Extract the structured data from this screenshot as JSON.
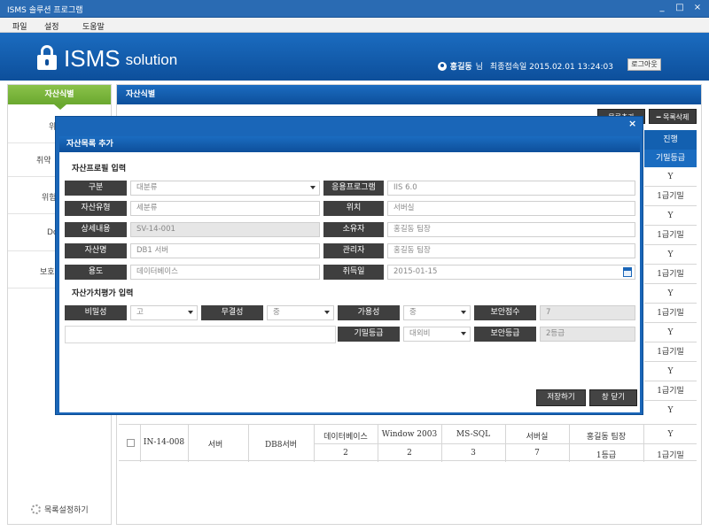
{
  "window": {
    "title": "ISMS 솔루션 프로그램",
    "controls": [
      "_",
      "□",
      "×"
    ]
  },
  "menu": [
    "파일",
    "설정",
    "도움말"
  ],
  "header": {
    "logo_big": "ISMS",
    "logo_small": "solution",
    "user_name": "홍길동",
    "user_suffix": "님",
    "last_login": "최종접속일 2015.02.01 13:24:03",
    "logout": "로그아웃"
  },
  "sidebar": {
    "title": "자산식별",
    "items": [
      "위",
      "취약",
      "위험",
      "Do",
      "보호"
    ],
    "footer": "목록설정하기"
  },
  "main": {
    "title": "자산식별",
    "add_button": "목록추가",
    "delete_button": "━ 목록삭제",
    "column_header": "진행",
    "column_sub": "기밀등급",
    "right_column": [
      "Y",
      "1급기밀",
      "Y",
      "1급기밀",
      "Y",
      "1급기밀",
      "Y",
      "1급기밀",
      "Y",
      "1급기밀",
      "Y",
      "1급기밀",
      "Y"
    ],
    "last_row": {
      "id": "IN-14-008",
      "type": "서버",
      "name": "DB8서버",
      "top": [
        "데이터베이스",
        "Window 2003",
        "MS-SQL",
        "서버실",
        "홍길동 팀장",
        "Y"
      ],
      "bottom": [
        "2",
        "2",
        "3",
        "7",
        "1등급",
        "1급기밀"
      ]
    }
  },
  "modal": {
    "title": "자산목록 추가",
    "section1": "자산프로필 입력",
    "section2": "자산가치평가 입력",
    "fields": {
      "category": {
        "label": "구분",
        "value": "대분류"
      },
      "app": {
        "label": "응용프로그램",
        "value": "IIS 6.0"
      },
      "asset_type": {
        "label": "자산유형",
        "value": "세분류"
      },
      "location": {
        "label": "위치",
        "value": "서버실"
      },
      "detail": {
        "label": "상세내용",
        "value": "SV-14-001"
      },
      "owner": {
        "label": "소유자",
        "value": "홍길동 팀장"
      },
      "asset_name": {
        "label": "자산명",
        "value": "DB1 서버"
      },
      "manager": {
        "label": "관리자",
        "value": "홍길동 팀장"
      },
      "usage": {
        "label": "용도",
        "value": "데이터베이스"
      },
      "acquired": {
        "label": "취득일",
        "value": "2015-01-15"
      }
    },
    "valuation": {
      "confidentiality": {
        "label": "비밀성",
        "value": "고"
      },
      "integrity": {
        "label": "무결성",
        "value": "중"
      },
      "availability": {
        "label": "가용성",
        "value": "중"
      },
      "security_score": {
        "label": "보안점수",
        "value": "7"
      },
      "secrecy_grade": {
        "label": "기밀등급",
        "value": "대외비"
      },
      "security_grade": {
        "label": "보안등급",
        "value": "2등급"
      }
    },
    "save": "저장하기",
    "close": "창 닫기"
  },
  "colors": {
    "blue": "#0d4f9b",
    "green": "#6aa82f",
    "dark": "#3f3f3f"
  }
}
